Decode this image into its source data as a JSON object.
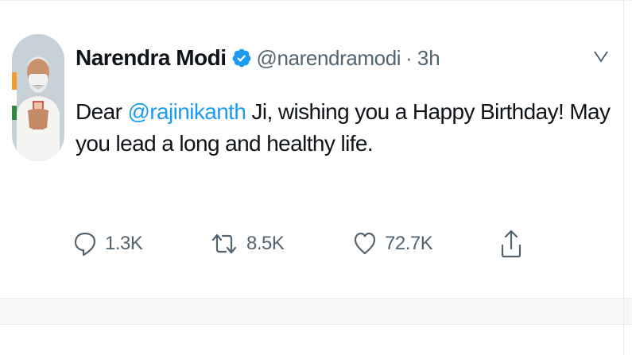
{
  "tweet": {
    "author_name": "Narendra Modi",
    "handle": "@narendramodi",
    "separator": "·",
    "time": "3h",
    "text_before": "Dear ",
    "mention": "@rajinikanth",
    "text_after": " Ji, wishing you a Happy Birthday! May you lead a long and healthy life.",
    "verified_icon": "verified-badge-icon",
    "more_icon": "chevron-down-icon"
  },
  "actions": {
    "reply": {
      "icon": "reply-icon",
      "count": "1.3K"
    },
    "retweet": {
      "icon": "retweet-icon",
      "count": "8.5K"
    },
    "like": {
      "icon": "heart-icon",
      "count": "72.7K"
    },
    "share": {
      "icon": "share-icon"
    }
  },
  "colors": {
    "accent": "#1d9bf0",
    "text": "#0f1419",
    "secondary": "#536471",
    "verified": "#1d9bf0"
  }
}
